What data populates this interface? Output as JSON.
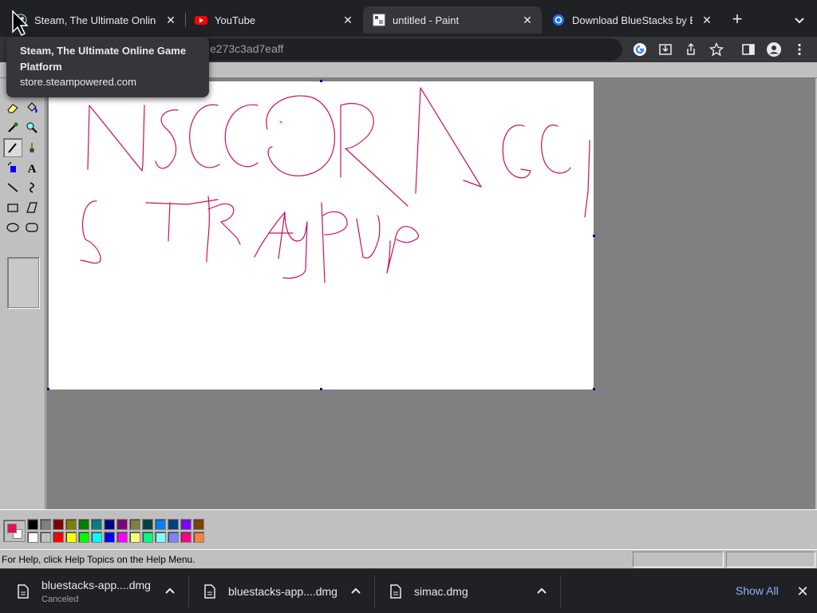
{
  "browser": {
    "tabs": [
      {
        "title": "Steam, The Ultimate Online Game Platform",
        "favicon": "steam-icon"
      },
      {
        "title": "YouTube",
        "favicon": "youtube-icon"
      },
      {
        "title": "untitled - Paint",
        "favicon": "paint-icon",
        "active": true
      },
      {
        "title": "Download BlueStacks by BlueStacks",
        "favicon": "bluestacks-icon"
      }
    ],
    "address_bar": {
      "partial_url": "e273c3ad7eaff"
    },
    "tooltip": {
      "title": "Steam, The Ultimate Online Game Platform",
      "url": "store.steampowered.com"
    }
  },
  "paint": {
    "status_text": "For Help, click Help Topics on the Help Menu.",
    "foreground_color": "#e0105a",
    "background_color": "#ffffff",
    "palette": {
      "row1": [
        "#000000",
        "#808080",
        "#800000",
        "#808000",
        "#008000",
        "#008080",
        "#000080",
        "#800080",
        "#808040",
        "#004040",
        "#0080ff",
        "#004080",
        "#8000ff",
        "#804000"
      ],
      "row2": [
        "#ffffff",
        "#c0c0c0",
        "#ff0000",
        "#ffff00",
        "#00ff00",
        "#00ffff",
        "#0000ff",
        "#ff00ff",
        "#ffff80",
        "#00ff80",
        "#80ffff",
        "#8080ff",
        "#ff0080",
        "#ff8040"
      ]
    },
    "tools": [
      "free-select-icon",
      "rect-select-icon",
      "eraser-icon",
      "fill-bucket-icon",
      "color-picker-icon",
      "magnifier-icon",
      "pencil-icon",
      "brush-icon",
      "airbrush-icon",
      "text-icon",
      "line-icon",
      "curve-icon",
      "rectangle-icon",
      "polygon-icon",
      "ellipse-icon",
      "rounded-rect-icon"
    ],
    "selected_tool": "pencil-icon",
    "stroke_color": "#c8105a"
  },
  "downloads": {
    "items": [
      {
        "name": "bluestacks-app....dmg",
        "status": "Canceled"
      },
      {
        "name": "bluestacks-app....dmg",
        "status": ""
      },
      {
        "name": "simac.dmg",
        "status": ""
      }
    ],
    "show_all": "Show All"
  }
}
